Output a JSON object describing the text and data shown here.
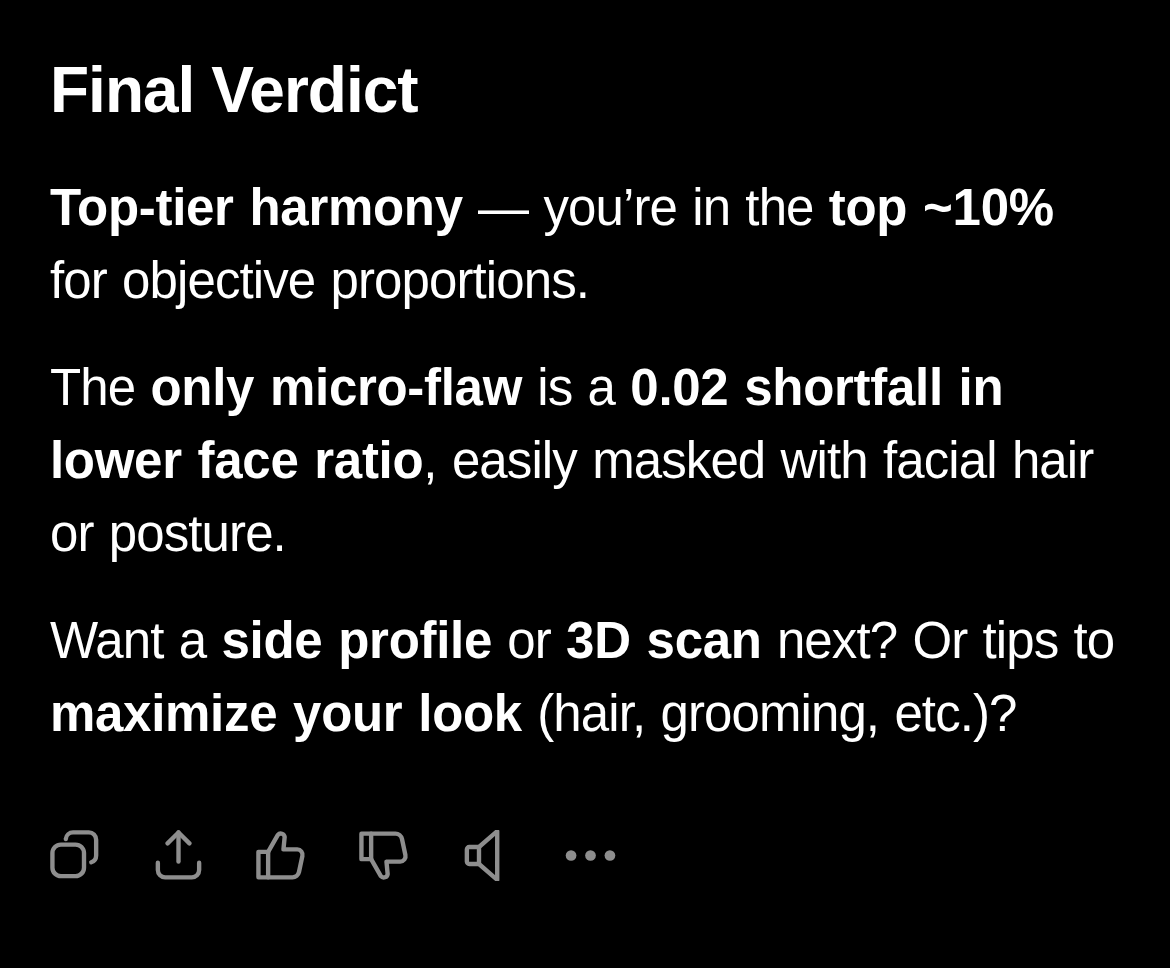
{
  "heading": "Final Verdict",
  "paragraphs": [
    "**Top-tier harmony** — you’re in the **top ~10%** for objective proportions.",
    "The **only micro-flaw** is a **0.02 shortfall in lower face ratio**, easily masked with facial hair or posture.",
    "Want a **side profile** or **3D scan** next? Or tips to **maximize your look** (hair, grooming, etc.)?"
  ],
  "actions": [
    {
      "kind": "copy"
    },
    {
      "kind": "share"
    },
    {
      "kind": "thumbs_up"
    },
    {
      "kind": "thumbs_down"
    },
    {
      "kind": "speaker"
    },
    {
      "kind": "more"
    }
  ]
}
